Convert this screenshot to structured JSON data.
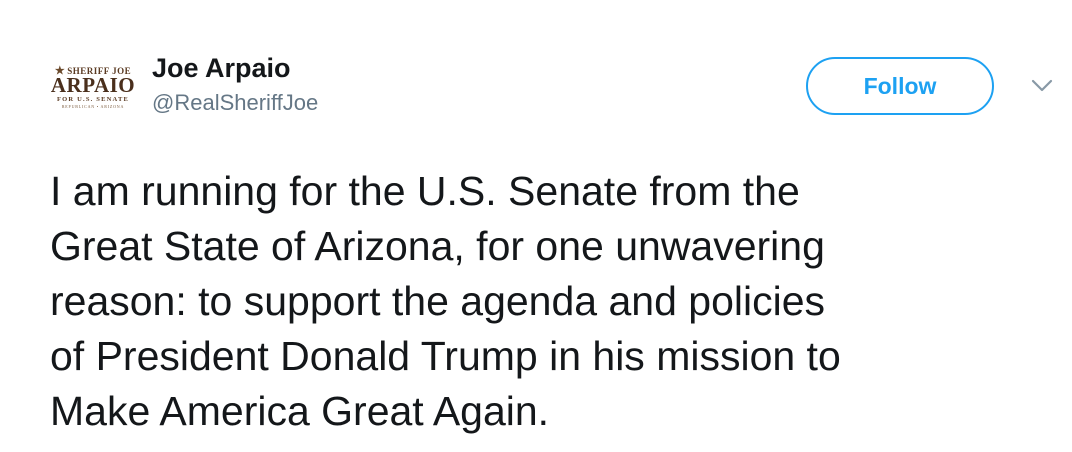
{
  "tweet": {
    "avatar": {
      "line1": "SHERIFF JOE",
      "line2": "ARPAIO",
      "line3": "FOR U.S. SENATE",
      "line4": "REPUBLICAN • ARIZONA",
      "brand_color": "#4a2f1c"
    },
    "author_name": "Joe Arpaio",
    "author_handle": "@RealSheriffJoe",
    "follow_label": "Follow",
    "menu_icon": "chevron-down-icon",
    "text_lines": [
      "I am running for the U.S. Senate from the",
      "Great State of Arizona, for one unwavering",
      "reason: to support the agenda and policies",
      "of President Donald Trump in his mission to",
      "Make America Great Again."
    ],
    "colors": {
      "accent": "#1da1f2",
      "text": "#14171a",
      "secondary": "#657786",
      "caret": "#8899a6"
    }
  }
}
